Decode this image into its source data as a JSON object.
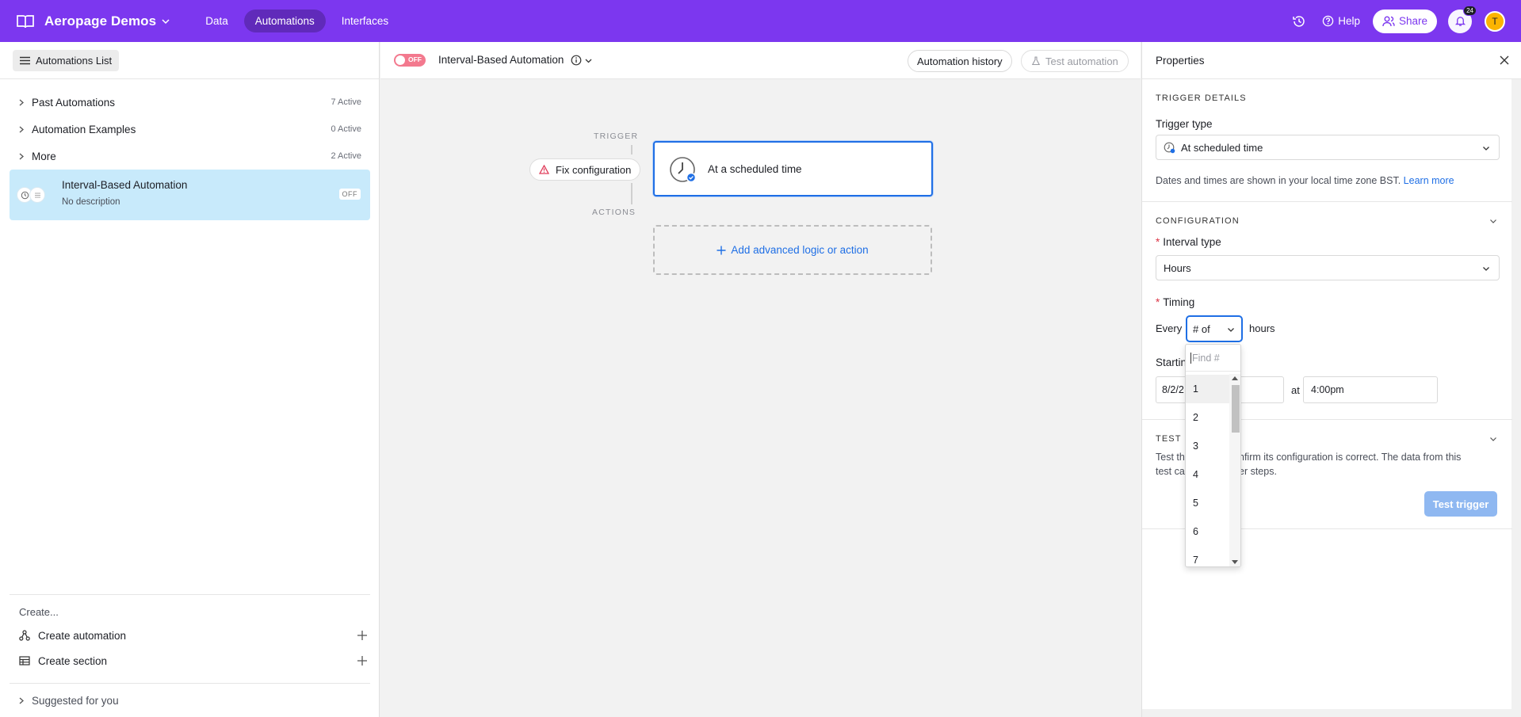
{
  "colors": {
    "brand": "#7c37ef",
    "accent": "#1f6fe5",
    "toggle_off": "#f3798e",
    "selected_row": "#c8eafb",
    "avatar": "#fcb400"
  },
  "topbar": {
    "brand_name": "Aeropage Demos",
    "tabs": [
      {
        "label": "Data",
        "active": false
      },
      {
        "label": "Automations",
        "active": true
      },
      {
        "label": "Interfaces",
        "active": false
      }
    ],
    "help_label": "Help",
    "share_label": "Share",
    "notifications_count": "24",
    "avatar_initial": "T"
  },
  "sidebar": {
    "list_button": "Automations List",
    "sections": [
      {
        "label": "Past Automations",
        "count": "7 Active"
      },
      {
        "label": "Automation Examples",
        "count": "0 Active"
      },
      {
        "label": "More",
        "count": "2 Active"
      }
    ],
    "selected": {
      "title": "Interval-Based Automation",
      "description": "No description",
      "status": "OFF"
    },
    "create_label": "Create...",
    "create_items": [
      {
        "label": "Create automation"
      },
      {
        "label": "Create section"
      }
    ],
    "suggested": "Suggested for you"
  },
  "canvas": {
    "toggle_label": "OFF",
    "title": "Interval-Based Automation",
    "history_button": "Automation history",
    "test_button": "Test automation",
    "trigger_label": "TRIGGER",
    "actions_label": "ACTIONS",
    "fix_button": "Fix configuration",
    "trigger_card": "At a scheduled time",
    "add_action": "Add advanced logic or action"
  },
  "properties": {
    "title": "Properties",
    "trigger_details": "TRIGGER DETAILS",
    "trigger_type_label": "Trigger type",
    "trigger_type_value": "At scheduled time",
    "hint": "Dates and times are shown in your local time zone BST.",
    "hint_link": "Learn more",
    "configuration": "CONFIGURATION",
    "interval_type_label": "Interval type",
    "interval_type_value": "Hours",
    "timing_label": "Timing",
    "every": "Every",
    "timing_value": "# of",
    "hours": "hours",
    "starting_label": "Startin",
    "date_value": "8/2/2",
    "at": "at",
    "time_value": "4:00pm",
    "test_step_label": "TEST S",
    "test_desc_a": "Test th",
    "test_desc_b": "confirm its configuration is correct. The data from this",
    "test_desc_c": "test ca",
    "test_desc_d": "later steps.",
    "test_trigger": "Test trigger"
  },
  "dropdown": {
    "search_placeholder": "Find #",
    "options": [
      "1",
      "2",
      "3",
      "4",
      "5",
      "6",
      "7"
    ]
  }
}
